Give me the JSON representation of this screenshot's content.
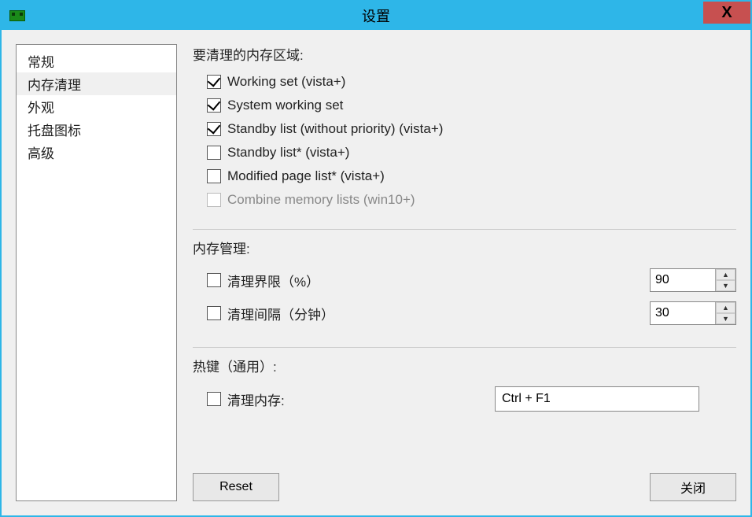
{
  "window": {
    "title": "设置",
    "close_label": "X"
  },
  "sidebar": {
    "items": [
      {
        "label": "常规",
        "selected": false
      },
      {
        "label": "内存清理",
        "selected": true
      },
      {
        "label": "外观",
        "selected": false
      },
      {
        "label": "托盘图标",
        "selected": false
      },
      {
        "label": "高级",
        "selected": false
      }
    ]
  },
  "section_areas": {
    "title": "要清理的内存区域:",
    "items": [
      {
        "label": "Working set (vista+)",
        "checked": true,
        "disabled": false
      },
      {
        "label": "System working set",
        "checked": true,
        "disabled": false
      },
      {
        "label": "Standby list (without priority) (vista+)",
        "checked": true,
        "disabled": false
      },
      {
        "label": "Standby list* (vista+)",
        "checked": false,
        "disabled": false
      },
      {
        "label": "Modified page list* (vista+)",
        "checked": false,
        "disabled": false
      },
      {
        "label": "Combine memory lists (win10+)",
        "checked": false,
        "disabled": true
      }
    ]
  },
  "section_mgmt": {
    "title": "内存管理:",
    "items": [
      {
        "label": "清理界限（%）",
        "checked": false,
        "value": "90"
      },
      {
        "label": "清理间隔（分钟）",
        "checked": false,
        "value": "30"
      }
    ]
  },
  "section_hotkey": {
    "title": "热键（通用）:",
    "item": {
      "label": "清理内存:",
      "checked": false,
      "value": "Ctrl + F1"
    }
  },
  "buttons": {
    "reset": "Reset",
    "close": "关闭"
  }
}
